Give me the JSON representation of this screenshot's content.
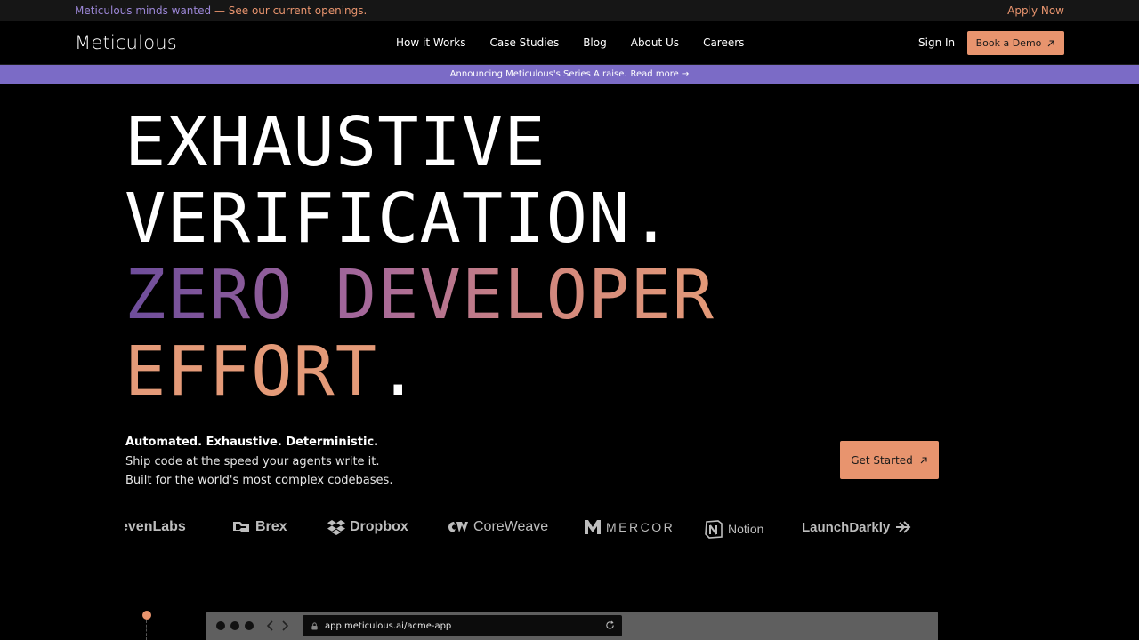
{
  "topbar": {
    "message_primary": "Meticulous minds wanted",
    "message_dash": " — ",
    "message_link": "See our current openings.",
    "apply_label": "Apply Now"
  },
  "nav": {
    "logo": "Meticulous",
    "links": [
      "How it Works",
      "Case Studies",
      "Blog",
      "About Us",
      "Careers"
    ],
    "sign_in": "Sign In",
    "book_demo": "Book a Demo"
  },
  "announcement": {
    "text": "Announcing Meticulous's Series A raise.",
    "link": "Read more →"
  },
  "hero": {
    "line1": "EXHAUSTIVE",
    "line2": "VERIFICATION",
    "line2_dot": ".",
    "line3": "ZERO DEVELOPER",
    "line4": "EFFORT",
    "line4_dot": "."
  },
  "subcopy": {
    "tagline": "Automated. Exhaustive. Deterministic.",
    "line1": "Ship code at the speed your agents write it.",
    "line2": "Built for the world's most complex codebases.",
    "cta": "Get Started"
  },
  "customers": [
    {
      "name": "evenLabs",
      "icon": "none"
    },
    {
      "name": "Brex",
      "icon": "brex-icon"
    },
    {
      "name": "Dropbox",
      "icon": "dropbox-icon"
    },
    {
      "name": "CoreWeave",
      "icon": "coreweave-icon"
    },
    {
      "name": "MERCOR",
      "icon": "mercor-icon"
    },
    {
      "name": "Notion",
      "icon": "notion-icon"
    },
    {
      "name": "LaunchDarkly",
      "icon": "launchdarkly-icon"
    }
  ],
  "browser": {
    "url": "app.meticulous.ai/acme-app"
  },
  "colors": {
    "accent": "#e8946e",
    "purple": "#7b6bc6",
    "gradient_start": "#6d4d9b",
    "gradient_end": "#e49a78"
  }
}
